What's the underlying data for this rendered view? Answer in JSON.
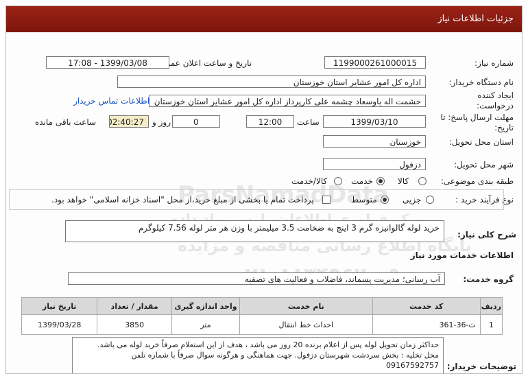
{
  "header": {
    "title": "جزئیات اطلاعات نیاز"
  },
  "fields": {
    "need_number_label": "شماره نیاز:",
    "need_number": "1199000261000015",
    "announce_label": "تاریخ و ساعت اعلان عمومی:",
    "announce_value": "1399/03/08 - 17:08",
    "buyer_label": "نام دستگاه خریدار:",
    "buyer_value": "اداره کل امور عشایر استان خوزستان",
    "creator_label": "ایجاد کننده درخواست:",
    "creator_value": "حشمت اله باوسعاد چشمه علی کارپرداز اداره کل امور عشایر استان خوزستان",
    "contact_link": "اطلاعات تماس خریدار",
    "deadline_label": "مهلت ارسال پاسخ: تا تاریخ:",
    "deadline_date": "1399/03/10",
    "time_label": "ساعت",
    "deadline_time": "12:00",
    "days_value": "0",
    "days_label": "روز و",
    "remaining_value": "02:40:27",
    "remaining_label": "ساعت باقی مانده",
    "province_label": "استان محل تحویل:",
    "province_value": "خوزستان",
    "city_label": "شهر محل تحویل:",
    "city_value": "دزفول",
    "category_label": "طبقه بندی موضوعی:",
    "category_options": [
      "کالا",
      "خدمت",
      "کالا/خدمت"
    ],
    "category_selected": "خدمت",
    "process_label": "نوع فرآیند خرید :",
    "process_options": [
      "جزیی",
      "متوسط"
    ],
    "process_selected": "متوسط",
    "payment_note": "پرداخت تمام یا بخشی از مبلغ خرید،از محل \"اسناد خزانه اسلامی\" خواهد بود."
  },
  "summary": {
    "label": "شرح کلی نیاز:",
    "value": "خرید لوله گالوانیزه گرم 3 اینچ به ضخامت 3.5 میلیمتر با وزن هر متر لوله 7.56 کیلوگرم"
  },
  "services": {
    "section_title": "اطلاعات خدمات مورد نیاز",
    "group_label": "گروه خدمت:",
    "group_value": "آب رسانی؛ مدیریت پسماند، فاضلاب و فعالیت های تصفیه",
    "columns": [
      "ردیف",
      "کد خدمت",
      "نام خدمت",
      "واحد اندازه گیری",
      "مقدار / تعداد",
      "تاریخ نیاز"
    ],
    "rows": [
      [
        "1",
        "ث-36-361",
        "احداث خط انتقال",
        "متر",
        "3850",
        "1399/03/28"
      ]
    ]
  },
  "notes": {
    "label": "توضیحات خریدار:",
    "lines": [
      "حداکثر زمان تحویل لوله پس از اعلام برنده 20 روز می باشد ، هدف از این استعلام صرفاً خرید لوله می باشد.",
      "محل تخلیه : بخش سردشت شهرستان دزفول. جهت هماهنگی و هرگونه سوال صرفاً  با شماره تلفن",
      "09167592757"
    ]
  },
  "watermark": {
    "brand": "ParsNamadData",
    "line1": "مرکز فراوری اطلاعات پارس نماد داده",
    "line2": "پایگاه اطلاع رسانی مناقصه و مزایده",
    "line3": "۰۲۱-۸۸۳۴۹۶۷۰-۵"
  }
}
